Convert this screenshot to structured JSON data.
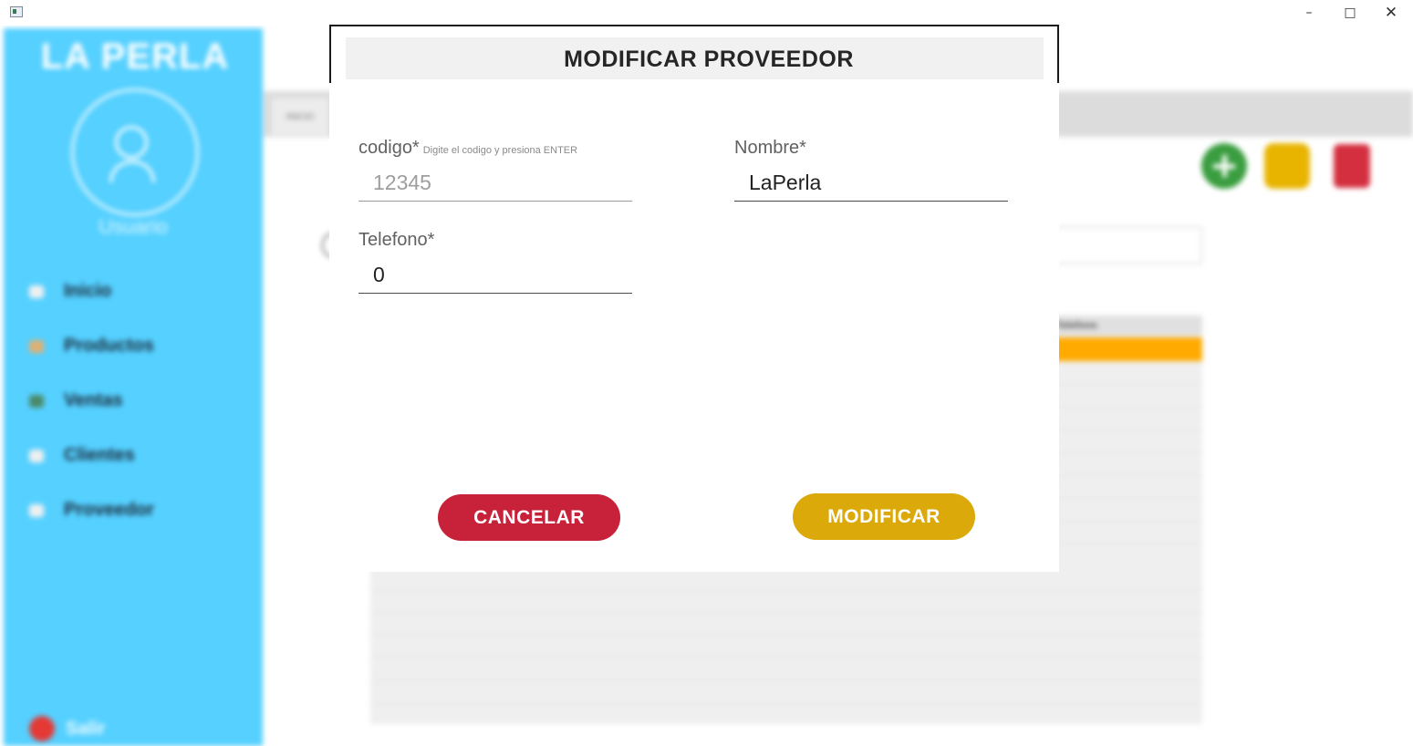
{
  "window": {
    "minimize_glyph": "–",
    "maximize_glyph": "□",
    "close_glyph": "✕"
  },
  "background": {
    "brand": "LA PERLA",
    "user_label": "Usuario",
    "tab_label": "INICIO",
    "nav_items": [
      {
        "label": "Inicio",
        "icon": "home-icon",
        "color": "#f0f0f0"
      },
      {
        "label": "Productos",
        "icon": "products-icon",
        "color": "#e0b070"
      },
      {
        "label": "Ventas",
        "icon": "sales-icon",
        "color": "#4a8a6a"
      },
      {
        "label": "Clientes",
        "icon": "clients-icon",
        "color": "#f0f0f0"
      },
      {
        "label": "Proveedor",
        "icon": "supplier-icon",
        "color": "#f0f0f0"
      }
    ],
    "logout_label": "Salir",
    "grid_header": "Telefono",
    "colors": {
      "sidebar": "#55d0ff",
      "selected_row": "#ffaa00"
    }
  },
  "dialog": {
    "title": "MODIFICAR PROVEEDOR",
    "codigo": {
      "label": "codigo*",
      "hint": "Digite el codigo y presiona ENTER",
      "value": "12345"
    },
    "nombre": {
      "label": "Nombre*",
      "value": "LaPerla"
    },
    "telefono": {
      "label": "Telefono*",
      "value": "0"
    },
    "cancel_label": "CANCELAR",
    "modify_label": "MODIFICAR",
    "colors": {
      "cancel": "#c8213a",
      "modify": "#dba90a"
    }
  }
}
